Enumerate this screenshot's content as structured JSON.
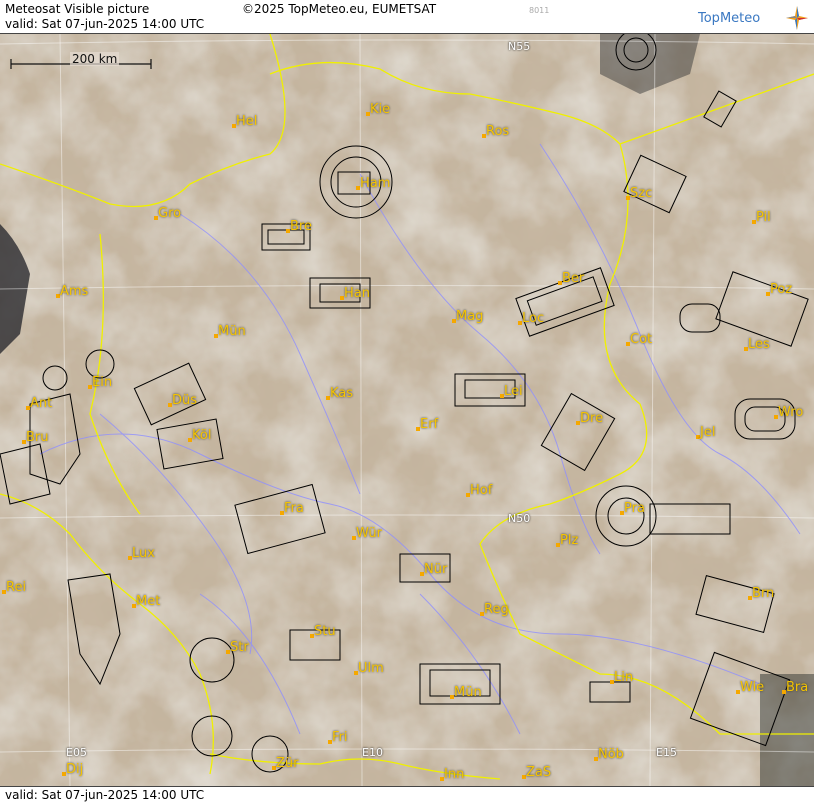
{
  "header": {
    "title": "Meteosat Visible picture",
    "valid": "valid:  Sat  07-jun-2025  14:00 UTC",
    "copyright": "©2025 TopMeteo.eu, EUMETSAT",
    "code": "8011",
    "logo_text": "TopMeteo",
    "logo_icon": "compass-star-icon"
  },
  "footer": {
    "valid": "valid:  Sat  07-jun-2025  14:00 UTC"
  },
  "scale": {
    "label": "200 km"
  },
  "grid_labels": [
    {
      "id": "n55",
      "text": "N55"
    },
    {
      "id": "n50",
      "text": "N50"
    },
    {
      "id": "e05",
      "text": "E05"
    },
    {
      "id": "e10",
      "text": "E10"
    },
    {
      "id": "e15",
      "text": "E15"
    }
  ],
  "cities": [
    {
      "id": "hel",
      "text": "Hel"
    },
    {
      "id": "kie",
      "text": "Kie"
    },
    {
      "id": "ros",
      "text": "Ros"
    },
    {
      "id": "ham",
      "text": "Ham"
    },
    {
      "id": "szc",
      "text": "Szc"
    },
    {
      "id": "pil",
      "text": "Pil"
    },
    {
      "id": "gro",
      "text": "Gro"
    },
    {
      "id": "bre",
      "text": "Bre"
    },
    {
      "id": "ber",
      "text": "Ber"
    },
    {
      "id": "ams",
      "text": "Ams"
    },
    {
      "id": "han",
      "text": "Han"
    },
    {
      "id": "poz",
      "text": "Poz"
    },
    {
      "id": "mun",
      "text": "Mün"
    },
    {
      "id": "mag",
      "text": "Mag"
    },
    {
      "id": "loc",
      "text": "Loc"
    },
    {
      "id": "cot",
      "text": "Cot"
    },
    {
      "id": "les",
      "text": "Les"
    },
    {
      "id": "ein",
      "text": "Ein"
    },
    {
      "id": "ant",
      "text": "Ant"
    },
    {
      "id": "dus",
      "text": "Düs"
    },
    {
      "id": "kas",
      "text": "Kas"
    },
    {
      "id": "lei",
      "text": "Lei"
    },
    {
      "id": "wro",
      "text": "Wro"
    },
    {
      "id": "bru",
      "text": "Bru"
    },
    {
      "id": "kol",
      "text": "Köl"
    },
    {
      "id": "erf",
      "text": "Erf"
    },
    {
      "id": "dre",
      "text": "Dre"
    },
    {
      "id": "jel",
      "text": "Jel"
    },
    {
      "id": "hof",
      "text": "Hof"
    },
    {
      "id": "fra",
      "text": "Fra"
    },
    {
      "id": "pra",
      "text": "Pra"
    },
    {
      "id": "wur",
      "text": "Wür"
    },
    {
      "id": "plz",
      "text": "Plz"
    },
    {
      "id": "lux",
      "text": "Lux"
    },
    {
      "id": "nur",
      "text": "Nür"
    },
    {
      "id": "rei",
      "text": "Rei"
    },
    {
      "id": "met",
      "text": "Met"
    },
    {
      "id": "reg",
      "text": "Reg"
    },
    {
      "id": "brn",
      "text": "Brn"
    },
    {
      "id": "stu",
      "text": "Stu"
    },
    {
      "id": "str",
      "text": "Str"
    },
    {
      "id": "ulm",
      "text": "Ulm"
    },
    {
      "id": "lin",
      "text": "Lin"
    },
    {
      "id": "mun2",
      "text": "Mün"
    },
    {
      "id": "wie",
      "text": "Wie"
    },
    {
      "id": "bra",
      "text": "Bra"
    },
    {
      "id": "fri",
      "text": "Fri"
    },
    {
      "id": "nob",
      "text": "Nöb"
    },
    {
      "id": "dij",
      "text": "Dij"
    },
    {
      "id": "zur",
      "text": "Zür"
    },
    {
      "id": "inn",
      "text": "Inn"
    },
    {
      "id": "zas",
      "text": "ZaS"
    }
  ],
  "colors": {
    "city_label": "#f5c400",
    "border": "#f0f000",
    "river": "#8f8fff",
    "grid": "#ffffff",
    "airspace": "#000000"
  }
}
